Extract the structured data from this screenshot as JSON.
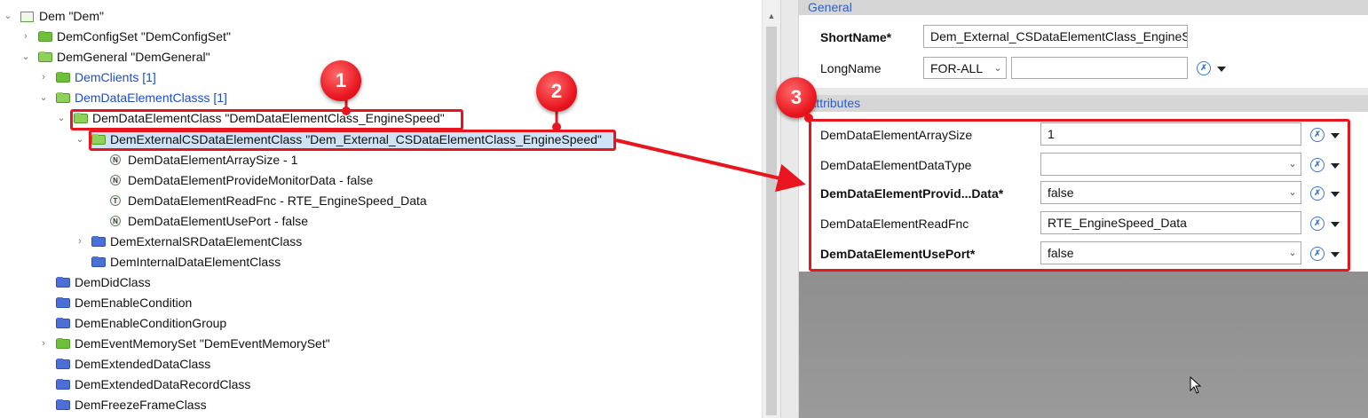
{
  "tree": {
    "items": [
      {
        "label": "Dem \"Dem\"",
        "icon": "module-icon",
        "expanded": true
      },
      {
        "label": "DemConfigSet \"DemConfigSet\"",
        "icon": "folder-green-icon",
        "expanded": false
      },
      {
        "label": "DemGeneral \"DemGeneral\"",
        "icon": "folder-green-icon",
        "expanded": true
      },
      {
        "label": "DemClients [1]",
        "icon": "folder-green-icon",
        "expanded": false
      },
      {
        "label": "DemDataElementClasss [1]",
        "icon": "folder-green-icon",
        "expanded": true
      },
      {
        "label": "DemDataElementClass \"DemDataElementClass_EngineSpeed\"",
        "icon": "folder-green-icon",
        "expanded": true
      },
      {
        "label": "DemExternalCSDataElementClass \"Dem_External_CSDataElementClass_EngineSpeed\"",
        "icon": "folder-green-icon",
        "expanded": true,
        "selected": true
      },
      {
        "label": "DemDataElementArraySize - 1",
        "icon": "numeric-param-icon"
      },
      {
        "label": "DemDataElementProvideMonitorData - false",
        "icon": "numeric-param-icon"
      },
      {
        "label": "DemDataElementReadFnc - RTE_EngineSpeed_Data",
        "icon": "text-param-icon"
      },
      {
        "label": "DemDataElementUsePort - false",
        "icon": "numeric-param-icon"
      },
      {
        "label": "DemExternalSRDataElementClass",
        "icon": "folder-blue-icon",
        "expanded": false
      },
      {
        "label": "DemInternalDataElementClass",
        "icon": "folder-blue-icon"
      },
      {
        "label": "DemDidClass",
        "icon": "folder-blue-icon"
      },
      {
        "label": "DemEnableCondition",
        "icon": "folder-blue-icon"
      },
      {
        "label": "DemEnableConditionGroup",
        "icon": "folder-blue-icon"
      },
      {
        "label": "DemEventMemorySet \"DemEventMemorySet\"",
        "icon": "folder-green-icon",
        "expanded": false
      },
      {
        "label": "DemExtendedDataClass",
        "icon": "folder-blue-icon"
      },
      {
        "label": "DemExtendedDataRecordClass",
        "icon": "folder-blue-icon"
      },
      {
        "label": "DemFreezeFrameClass",
        "icon": "folder-blue-icon"
      }
    ],
    "param_icon_letters": {
      "numeric": "N",
      "text": "T"
    }
  },
  "general": {
    "header": "General",
    "short_name_label": "ShortName*",
    "short_name_value": "Dem_External_CSDataElementClass_EngineSpeed",
    "long_name_label": "LongName",
    "long_name_lang": "FOR-ALL",
    "long_name_value": ""
  },
  "attributes": {
    "header": "Attributes",
    "rows": [
      {
        "label": "DemDataElementArraySize",
        "value": "1",
        "kind": "text",
        "bold": false
      },
      {
        "label": "DemDataElementDataType",
        "value": "",
        "kind": "combo",
        "bold": false
      },
      {
        "label": "DemDataElementProvid...Data*",
        "value": "false",
        "kind": "combo",
        "bold": true
      },
      {
        "label": "DemDataElementReadFnc",
        "value": "RTE_EngineSpeed_Data",
        "kind": "text",
        "bold": false
      },
      {
        "label": "DemDataElementUsePort*",
        "value": "false",
        "kind": "combo",
        "bold": true
      }
    ]
  },
  "callouts": [
    "1",
    "2",
    "3"
  ],
  "colors": {
    "highlight_red": "#e8141e",
    "section_header_text": "#2f5ec4",
    "link_blue": "#1a4cd6",
    "folder_green": "#6fbf3a",
    "folder_blue": "#4b6fd6"
  }
}
